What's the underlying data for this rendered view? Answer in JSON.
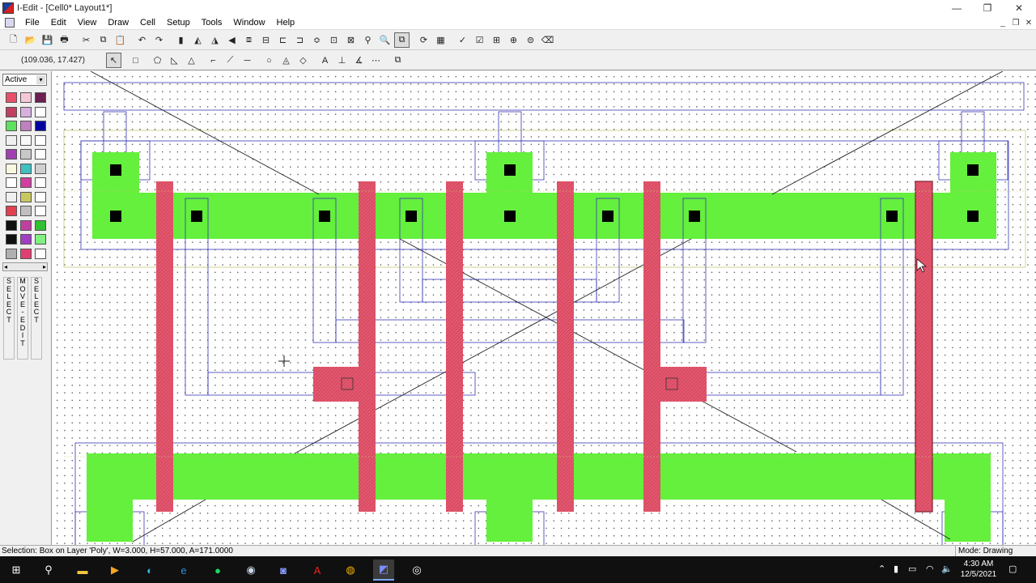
{
  "window": {
    "title": "I-Edit - [Cell0*     Layout1*]",
    "minimize": "—",
    "maximize": "❐",
    "close": "✕"
  },
  "menu": {
    "items": [
      "File",
      "Edit",
      "View",
      "Draw",
      "Cell",
      "Setup",
      "Tools",
      "Window",
      "Help"
    ],
    "mdi_minimize": "_",
    "mdi_restore": "❐",
    "mdi_close": "✕"
  },
  "toolbar1": {
    "icons": [
      "new-file",
      "open-file",
      "save",
      "print",
      "cut",
      "copy",
      "paste",
      "undo",
      "redo",
      "edit-in-place",
      "flip-h",
      "flip-v",
      "rotate",
      "merge",
      "slice",
      "group",
      "ungroup",
      "array",
      "instance",
      "cross-section",
      "find",
      "zoom",
      "zoom-fit",
      "redraw",
      "layer-palette",
      "drc",
      "drc-box",
      "spr",
      "extract",
      "lvs",
      "eraser"
    ]
  },
  "toolbar2": {
    "coordinates": "(109.036, 17.427)",
    "tools": [
      "select-arrow",
      "box",
      "polygon",
      "all-angle-polygon",
      "triangle",
      "wire-90",
      "wire-45",
      "wire-all",
      "circle",
      "pie-wedge",
      "torus",
      "port",
      "ruler-90",
      "ruler-45",
      "ruler-all",
      "instance-tool"
    ]
  },
  "palette": {
    "active_layer": "Active",
    "mode_buttons": [
      {
        "label": "SELECT"
      },
      {
        "label": "MOVE-EDIT"
      },
      {
        "label": "SELECT"
      }
    ],
    "scroll_left": "◂",
    "scroll_right": "▸",
    "dropdown_arrow": "▾",
    "swatch_colors": [
      [
        "#e8506a",
        "#f4c8d8",
        "#6a2050"
      ],
      [
        "#c04060",
        "#d8b0e0",
        "#ffffff"
      ],
      [
        "#60e060",
        "#c080c0",
        "#0000a0"
      ],
      [
        "#f0f0f0",
        "#f8f8f8",
        "#ffffff"
      ],
      [
        "#a040b0",
        "#c8c8c8",
        "#ffffff"
      ],
      [
        "#f8f8e0",
        "#40c0c0",
        "#d0d0d0"
      ],
      [
        "#ffffff",
        "#d040a0",
        "#ffffff"
      ],
      [
        "#f0f0f0",
        "#c8c860",
        "#ffffff"
      ],
      [
        "#e04050",
        "#c0c0c0",
        "#ffffff"
      ],
      [
        "#101010",
        "#c040a0",
        "#30c030"
      ],
      [
        "#101010",
        "#a040c0",
        "#80f080"
      ],
      [
        "#b0b0b0",
        "#e04070",
        "#ffffff"
      ]
    ]
  },
  "status": {
    "selection": "Selection: Box on Layer 'Poly', W=3.000, H=57.000, A=171.0000",
    "mode": "Mode: Drawing"
  },
  "layout": {
    "colors": {
      "active": "#64f03c",
      "poly": "#e2586e",
      "contact": "#000000",
      "outline": "#3838b8",
      "select": "#c8c878",
      "cross": "#222222"
    }
  },
  "taskbar": {
    "time": "4:30 AM",
    "date": "12/5/2021",
    "apps": [
      "windows-start",
      "search",
      "file-explorer",
      "media-player",
      "edge",
      "internet-explorer",
      "spotify",
      "steam",
      "discord",
      "acrobat",
      "chrome",
      "l-edit",
      "obs"
    ]
  }
}
